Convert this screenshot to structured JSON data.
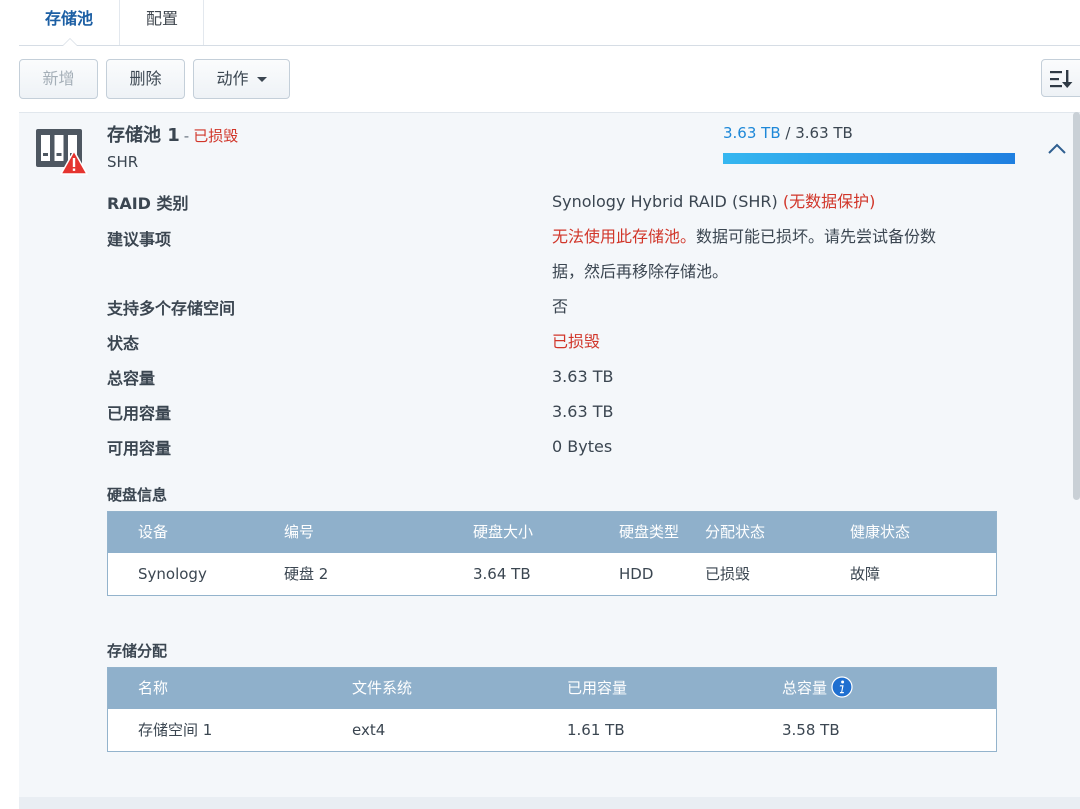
{
  "tabs": [
    {
      "label": "存储池"
    },
    {
      "label": "配置"
    }
  ],
  "toolbar": {
    "add_label": "新增",
    "delete_label": "删除",
    "action_label": "动作"
  },
  "pool": {
    "title": "存储池 1",
    "separator": "-",
    "status": "已损毁",
    "type": "SHR",
    "used": "3.63 TB",
    "usage_sep": " / ",
    "total": "3.63 TB",
    "usage_fraction": 1.0
  },
  "info": {
    "raid_label": "RAID 类别",
    "raid_value": "Synology Hybrid RAID (SHR) ",
    "raid_note": "(无数据保护)",
    "advice_label": "建议事项",
    "advice_red": "无法使用此存储池。",
    "advice_line1": "数据可能已损坏。请先尝试备份数",
    "advice_line2": "据，然后再移除存储池。",
    "multi_label": "支持多个存储空间",
    "multi_value": "否",
    "status_label": "状态",
    "status_value": "已损毁",
    "total_label": "总容量",
    "total_value": "3.63 TB",
    "used_label": "已用容量",
    "used_value": "3.63 TB",
    "free_label": "可用容量",
    "free_value": "0 Bytes"
  },
  "disk_section": {
    "title": "硬盘信息",
    "headers": [
      "设备",
      "编号",
      "硬盘大小",
      "硬盘类型",
      "分配状态",
      "健康状态"
    ],
    "rows": [
      [
        "Synology",
        "硬盘 2",
        "3.64 TB",
        "HDD",
        "已损毁",
        "故障"
      ]
    ]
  },
  "alloc_section": {
    "title": "存储分配",
    "headers": [
      "名称",
      "文件系统",
      "已用容量",
      "总容量"
    ],
    "rows": [
      [
        "存储空间 1",
        "ext4",
        "1.61 TB",
        "3.58 TB"
      ]
    ]
  },
  "colors": {
    "accent": "#1c5fa4",
    "danger": "#d1362a",
    "table_header": "#8fb0cb",
    "usage_bar": "#1e88d8"
  },
  "icons": [
    "storage-pool-warning-icon",
    "chevron-up-icon",
    "sort-icon",
    "info-icon",
    "caret-down-icon"
  ]
}
